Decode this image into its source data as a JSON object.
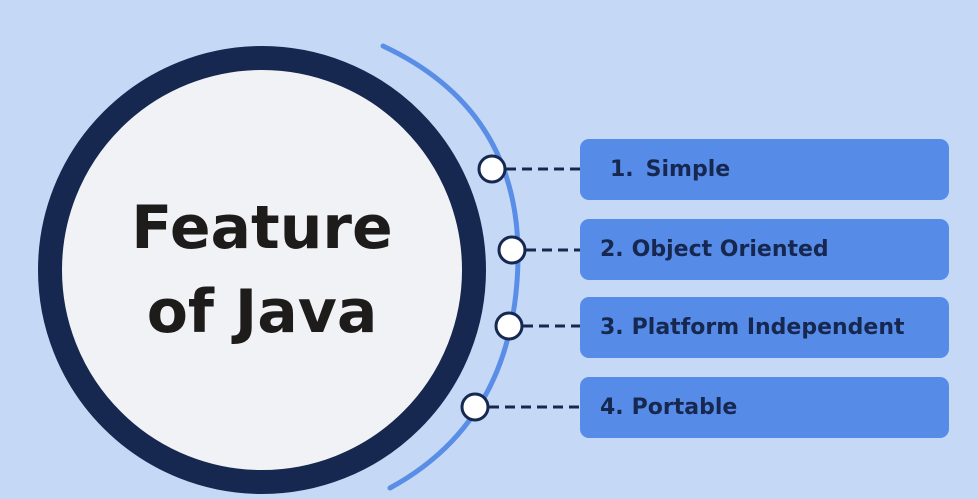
{
  "hub": {
    "line1": "Feature",
    "line2": "of Java"
  },
  "features": [
    {
      "number": "1.",
      "label": "Simple"
    },
    {
      "number": "2.",
      "label": "Object Oriented"
    },
    {
      "number": "3.",
      "label": "Platform Independent"
    },
    {
      "number": "4.",
      "label": "Portable"
    }
  ],
  "colors": {
    "background": "#c5d9f6",
    "hub_fill": "#f0f2f6",
    "hub_ring": "#162850",
    "hub_text": "#1e1b1b",
    "arc": "#5a8ee6",
    "connector": "#162850",
    "feature_box": "#578be8",
    "feature_text": "#162850"
  }
}
